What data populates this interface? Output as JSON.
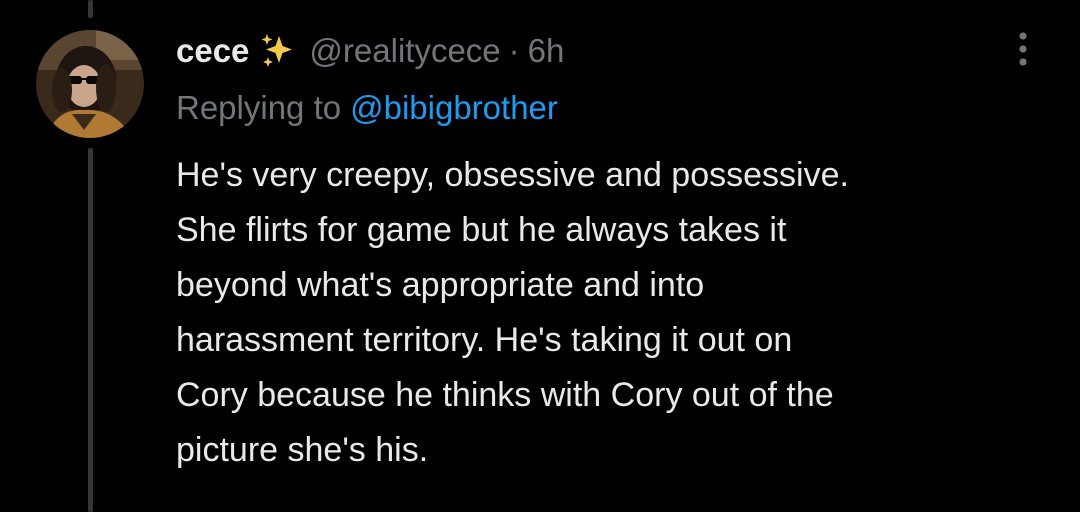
{
  "tweet": {
    "author": {
      "display_name": "cece",
      "emoji": "✨",
      "handle": "@realitycece",
      "separator": "·",
      "time_ago": "6h"
    },
    "reply_to": {
      "prefix": "Replying to",
      "mention": "@bibigbrother"
    },
    "body_lines": [
      "He's very creepy, obsessive and possessive.",
      "She flirts for game but he always takes it",
      "beyond what's appropriate and into",
      "harassment territory. He's taking it out on",
      "Cory because he thinks with Cory out of the",
      "picture she's his."
    ],
    "more_icon": "more-vertical-icon",
    "avatar_icon": "profile-photo"
  },
  "colors": {
    "background": "#000000",
    "text_primary": "#e7e9ea",
    "text_secondary": "#71767b",
    "accent": "#1d9bf0",
    "thread_line": "#333639"
  }
}
